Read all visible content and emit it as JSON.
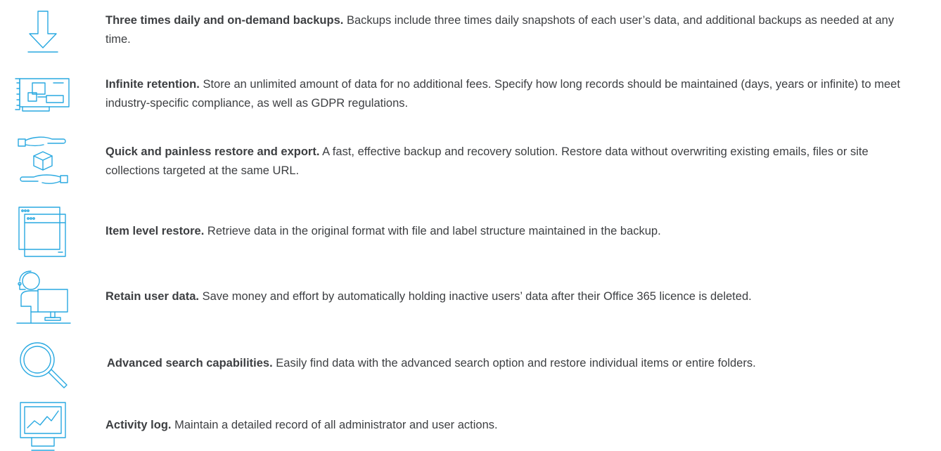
{
  "theme": {
    "icon_color": "#29a9e1",
    "text_color": "#3d3f42",
    "background": "#ffffff"
  },
  "features": [
    {
      "icon": "download-arrow-icon",
      "title": "Three times daily and on-demand backups.",
      "body": "Backups include three times daily snapshots of each user’s data, and additional backups as needed at any time."
    },
    {
      "icon": "circuit-board-icon",
      "title": "Infinite retention.",
      "body": "Store an unlimited amount of data for no additional fees. Specify how long records should be maintained (days, years or infinite) to meet industry-specific compliance, as well as GDPR regulations."
    },
    {
      "icon": "hand-over-box-icon",
      "title": "Quick and painless restore and export.",
      "body": "A fast, effective backup and recovery solution. Restore data without overwriting existing emails, files or site collections targeted at the same URL."
    },
    {
      "icon": "browser-windows-icon",
      "title": "Item level restore.",
      "body": "Retrieve data in the original format with file and label structure maintained in the backup."
    },
    {
      "icon": "user-at-computer-icon",
      "title": "Retain user data.",
      "body": "Save money and effort by automatically holding inactive users’ data after their Office 365 licence is deleted."
    },
    {
      "icon": "magnifier-icon",
      "title": "Advanced search capabilities.",
      "body": "Easily find data with the advanced search option and restore individual items or entire folders."
    },
    {
      "icon": "activity-monitor-icon",
      "title": "Activity log.",
      "body": "Maintain a detailed record of all administrator and user actions."
    }
  ]
}
